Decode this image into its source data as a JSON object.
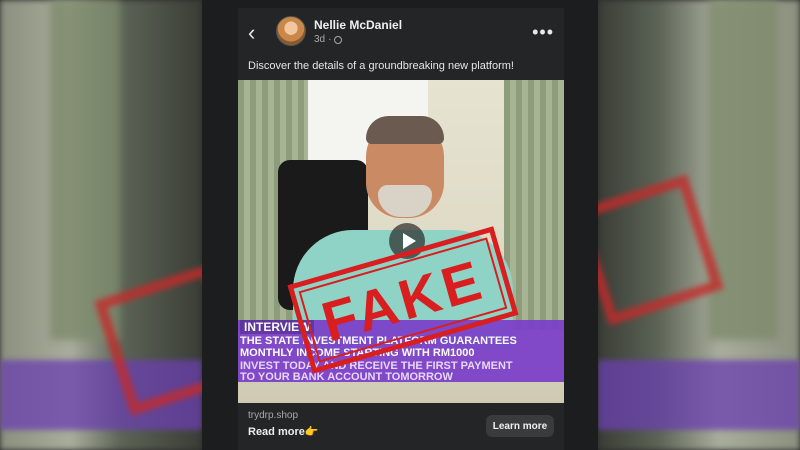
{
  "post": {
    "author": "Nellie McDaniel",
    "time": "3d",
    "caption": "Discover the details of a groundbreaking new platform!",
    "more_icon": "more-horizontal-icon",
    "back_icon": "chevron-left-icon"
  },
  "video": {
    "stamp_text": "FAKE",
    "banner": {
      "line1": "INTERVIEW",
      "line2": "THE STATE INVESTMENT PLATFORM GUARANTEES",
      "line3": "MONTHLY INCOME STARTING WITH RM1000",
      "line4": "INVEST TODAY AND RECEIVE THE FIRST PAYMENT",
      "line5": "TO YOUR BANK ACCOUNT TOMORROW"
    }
  },
  "footer": {
    "domain": "trydrp.shop",
    "read_more": "Read more👉",
    "cta_label": "Learn more"
  },
  "colors": {
    "stamp": "#d81e1e",
    "banner": "#7b3fc9",
    "background": "#242527"
  }
}
